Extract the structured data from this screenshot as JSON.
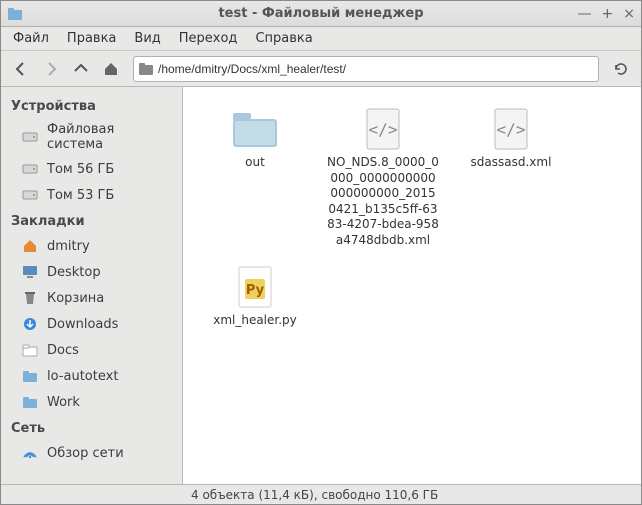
{
  "window": {
    "title": "test - Файловый менеджер"
  },
  "menu": {
    "file": "Файл",
    "edit": "Правка",
    "view": "Вид",
    "go": "Переход",
    "help": "Справка"
  },
  "path": {
    "value": "/home/dmitry/Docs/xml_healer/test/"
  },
  "sidebar": {
    "devices_header": "Устройства",
    "devices": [
      {
        "label": "Файловая система",
        "icon": "drive"
      },
      {
        "label": "Том 56 ГБ",
        "icon": "drive"
      },
      {
        "label": "Том 53 ГБ",
        "icon": "drive"
      }
    ],
    "bookmarks_header": "Закладки",
    "bookmarks": [
      {
        "label": "dmitry",
        "icon": "home"
      },
      {
        "label": "Desktop",
        "icon": "desktop"
      },
      {
        "label": "Корзина",
        "icon": "trash"
      },
      {
        "label": "Downloads",
        "icon": "downloads"
      },
      {
        "label": "Docs",
        "icon": "folder-simple"
      },
      {
        "label": "lo-autotext",
        "icon": "folder"
      },
      {
        "label": "Work",
        "icon": "folder"
      }
    ],
    "network_header": "Сеть",
    "network": [
      {
        "label": "Обзор сети",
        "icon": "network"
      }
    ]
  },
  "files": [
    {
      "label": "out",
      "type": "folder"
    },
    {
      "label": "NO_NDS.8_0000_0000_0000000000000000000_20150421_b135c5ff-6383-4207-bdea-958a4748dbdb.xml",
      "type": "xml"
    },
    {
      "label": "sdassasd.xml",
      "type": "xml"
    },
    {
      "label": "xml_healer.py",
      "type": "python"
    }
  ],
  "statusbar": {
    "text": "4 объекта (11,4 кБ), свободно 110,6 ГБ"
  }
}
